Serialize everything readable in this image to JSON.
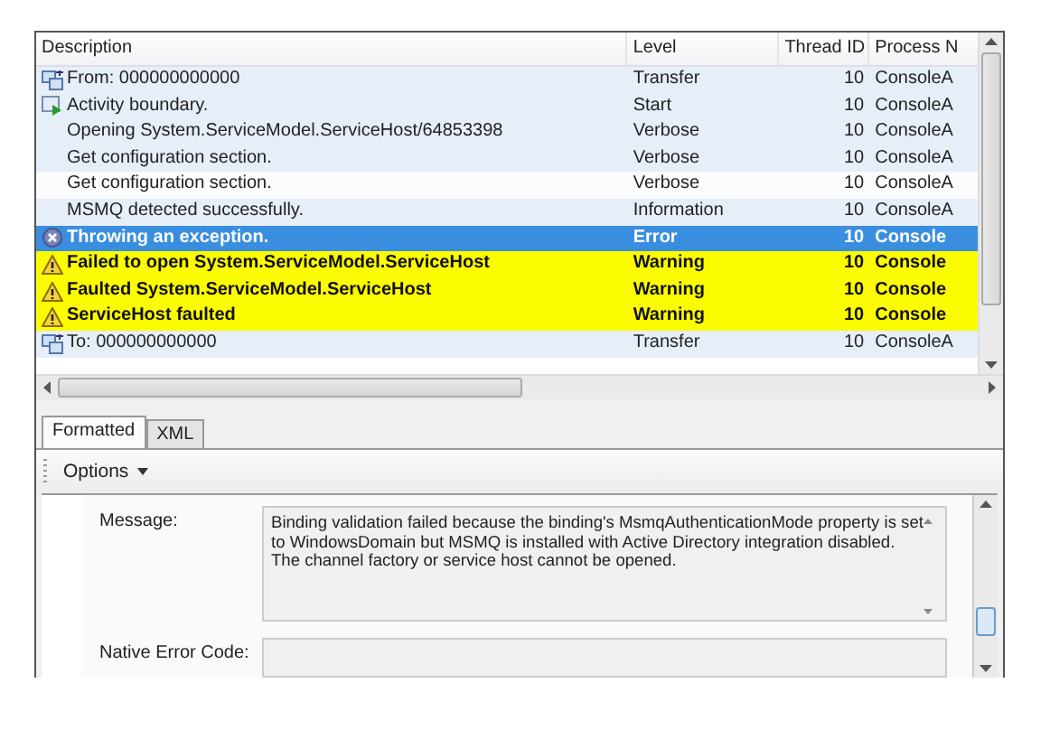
{
  "table": {
    "columns": [
      "Description",
      "Level",
      "Thread ID",
      "Process N"
    ],
    "rows": [
      {
        "kind": "transfer",
        "description": "From: 000000000000",
        "level": "Transfer",
        "thread": "10",
        "process": "ConsoleA",
        "selected": false,
        "flagged": false
      },
      {
        "kind": "activity",
        "description": "Activity boundary.",
        "level": "Start",
        "thread": "10",
        "process": "ConsoleA",
        "selected": false,
        "flagged": false
      },
      {
        "kind": "plain",
        "description": "Opening System.ServiceModel.ServiceHost/64853398",
        "level": "Verbose",
        "thread": "10",
        "process": "ConsoleA",
        "selected": false,
        "flagged": false
      },
      {
        "kind": "plain",
        "description": "Get configuration section.",
        "level": "Verbose",
        "thread": "10",
        "process": "ConsoleA",
        "selected": false,
        "flagged": false
      },
      {
        "kind": "plain",
        "description": "Get configuration section.",
        "level": "Verbose",
        "thread": "10",
        "process": "ConsoleA",
        "selected": false,
        "flagged": false
      },
      {
        "kind": "plain",
        "description": "MSMQ detected successfully.",
        "level": "Information",
        "thread": "10",
        "process": "ConsoleA",
        "selected": false,
        "flagged": false
      },
      {
        "kind": "error",
        "description": "Throwing an exception.",
        "level": "Error",
        "thread": "10",
        "process": "Console",
        "selected": true,
        "flagged": false
      },
      {
        "kind": "warning",
        "description": "Failed to open System.ServiceModel.ServiceHost",
        "level": "Warning",
        "thread": "10",
        "process": "Console",
        "selected": false,
        "flagged": true
      },
      {
        "kind": "warning",
        "description": "Faulted System.ServiceModel.ServiceHost",
        "level": "Warning",
        "thread": "10",
        "process": "Console",
        "selected": false,
        "flagged": true
      },
      {
        "kind": "warning",
        "description": "ServiceHost faulted",
        "level": "Warning",
        "thread": "10",
        "process": "Console",
        "selected": false,
        "flagged": true
      },
      {
        "kind": "transfer",
        "description": "To: 000000000000",
        "level": "Transfer",
        "thread": "10",
        "process": "ConsoleA",
        "selected": false,
        "flagged": false
      }
    ]
  },
  "tabs": [
    {
      "label": "Formatted",
      "selected": true
    },
    {
      "label": "XML",
      "selected": false
    }
  ],
  "toolbar": {
    "options": "Options"
  },
  "details": [
    {
      "label": "Message:",
      "value": "Binding validation failed because the binding's MsmqAuthenticationMode property is set to WindowsDomain but MSMQ is installed with Active Directory integration disabled. The channel factory or service host cannot be opened.",
      "kind": "multiline"
    },
    {
      "label": "Native Error Code:",
      "kind": "single"
    }
  ]
}
